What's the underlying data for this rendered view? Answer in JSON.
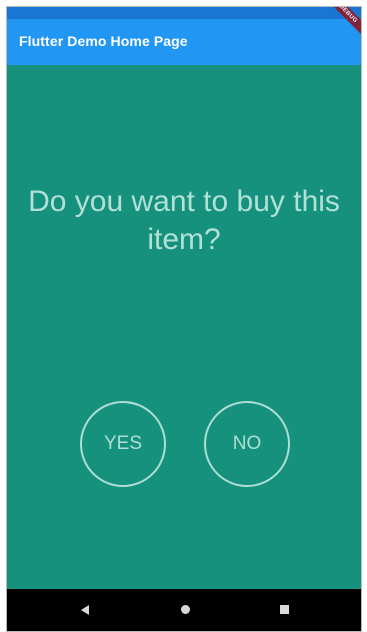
{
  "app_bar": {
    "title": "Flutter Demo Home Page",
    "color": "#2196f3",
    "status_color": "#1976d2"
  },
  "debug_banner": {
    "label": "DEBUG"
  },
  "content": {
    "question": "Do you want to buy this item?",
    "background": "#16917d",
    "buttons": [
      {
        "label": "YES"
      },
      {
        "label": "NO"
      }
    ]
  },
  "nav_bar": {
    "items": [
      {
        "icon": "back-icon"
      },
      {
        "icon": "home-icon"
      },
      {
        "icon": "recents-icon"
      }
    ]
  }
}
